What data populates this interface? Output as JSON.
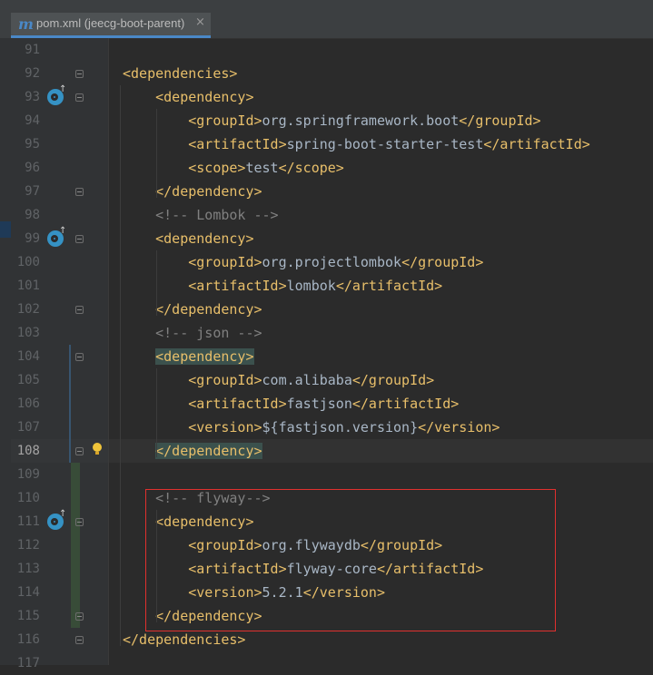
{
  "tab": {
    "icon": "maven-m-icon",
    "icon_text": "m",
    "title": "pom.xml (jeecg-boot-parent)",
    "close": "×"
  },
  "editor": {
    "lines": [
      {
        "num": "91",
        "indent": "",
        "parts": []
      },
      {
        "num": "92",
        "indent": "",
        "parts": [
          {
            "k": "tag",
            "v": "<dependencies>"
          }
        ]
      },
      {
        "num": "93",
        "indent": "    ",
        "parts": [
          {
            "k": "tag",
            "v": "<dependency>"
          }
        ]
      },
      {
        "num": "94",
        "indent": "        ",
        "parts": [
          {
            "k": "tag",
            "v": "<groupId>"
          },
          {
            "k": "text",
            "v": "org.springframework.boot"
          },
          {
            "k": "tag",
            "v": "</groupId>"
          }
        ]
      },
      {
        "num": "95",
        "indent": "        ",
        "parts": [
          {
            "k": "tag",
            "v": "<artifactId>"
          },
          {
            "k": "text",
            "v": "spring-boot-starter-test"
          },
          {
            "k": "tag",
            "v": "</artifactId>"
          }
        ]
      },
      {
        "num": "96",
        "indent": "        ",
        "parts": [
          {
            "k": "tag",
            "v": "<scope>"
          },
          {
            "k": "text",
            "v": "test"
          },
          {
            "k": "tag",
            "v": "</scope>"
          }
        ]
      },
      {
        "num": "97",
        "indent": "    ",
        "parts": [
          {
            "k": "tag",
            "v": "</dependency>"
          }
        ]
      },
      {
        "num": "98",
        "indent": "    ",
        "parts": [
          {
            "k": "comment",
            "v": "<!-- Lombok -->"
          }
        ]
      },
      {
        "num": "99",
        "indent": "    ",
        "parts": [
          {
            "k": "tag",
            "v": "<dependency>"
          }
        ]
      },
      {
        "num": "100",
        "indent": "        ",
        "parts": [
          {
            "k": "tag",
            "v": "<groupId>"
          },
          {
            "k": "text",
            "v": "org.projectlombok"
          },
          {
            "k": "tag",
            "v": "</groupId>"
          }
        ]
      },
      {
        "num": "101",
        "indent": "        ",
        "parts": [
          {
            "k": "tag",
            "v": "<artifactId>"
          },
          {
            "k": "text",
            "v": "lombok"
          },
          {
            "k": "tag",
            "v": "</artifactId>"
          }
        ]
      },
      {
        "num": "102",
        "indent": "    ",
        "parts": [
          {
            "k": "tag",
            "v": "</dependency>"
          }
        ]
      },
      {
        "num": "103",
        "indent": "    ",
        "parts": [
          {
            "k": "comment",
            "v": "<!-- json -->"
          }
        ]
      },
      {
        "num": "104",
        "indent": "    ",
        "parts": [
          {
            "k": "match",
            "v": "<dependency>"
          }
        ]
      },
      {
        "num": "105",
        "indent": "        ",
        "parts": [
          {
            "k": "tag",
            "v": "<groupId>"
          },
          {
            "k": "text",
            "v": "com.alibaba"
          },
          {
            "k": "tag",
            "v": "</groupId>"
          }
        ]
      },
      {
        "num": "106",
        "indent": "        ",
        "parts": [
          {
            "k": "tag",
            "v": "<artifactId>"
          },
          {
            "k": "text",
            "v": "fastjson"
          },
          {
            "k": "tag",
            "v": "</artifactId>"
          }
        ]
      },
      {
        "num": "107",
        "indent": "        ",
        "parts": [
          {
            "k": "tag",
            "v": "<version>"
          },
          {
            "k": "text",
            "v": "${fastjson.version}"
          },
          {
            "k": "tag",
            "v": "</version>"
          }
        ]
      },
      {
        "num": "108",
        "indent": "    ",
        "parts": [
          {
            "k": "match",
            "v": "</dependency>"
          }
        ]
      },
      {
        "num": "109",
        "indent": "",
        "parts": []
      },
      {
        "num": "110",
        "indent": "    ",
        "parts": [
          {
            "k": "comment",
            "v": "<!-- flyway-->"
          }
        ]
      },
      {
        "num": "111",
        "indent": "    ",
        "parts": [
          {
            "k": "tag",
            "v": "<dependency>"
          }
        ]
      },
      {
        "num": "112",
        "indent": "        ",
        "parts": [
          {
            "k": "tag",
            "v": "<groupId>"
          },
          {
            "k": "text",
            "v": "org.flywaydb"
          },
          {
            "k": "tag",
            "v": "</groupId>"
          }
        ]
      },
      {
        "num": "113",
        "indent": "        ",
        "parts": [
          {
            "k": "tag",
            "v": "<artifactId>"
          },
          {
            "k": "text",
            "v": "flyway-core"
          },
          {
            "k": "tag",
            "v": "</artifactId>"
          }
        ]
      },
      {
        "num": "114",
        "indent": "        ",
        "parts": [
          {
            "k": "tag",
            "v": "<version>"
          },
          {
            "k": "text",
            "v": "5.2.1"
          },
          {
            "k": "tag",
            "v": "</version>"
          }
        ]
      },
      {
        "num": "115",
        "indent": "    ",
        "parts": [
          {
            "k": "tag",
            "v": "</dependency>"
          }
        ]
      },
      {
        "num": "116",
        "indent": "",
        "parts": [
          {
            "k": "tag",
            "v": "</dependencies>"
          }
        ]
      },
      {
        "num": "117",
        "indent": "",
        "parts": []
      }
    ],
    "current_line": "108",
    "maven_icon_lines": [
      "93",
      "99",
      "111"
    ],
    "fold_lines": [
      "92",
      "93",
      "97",
      "99",
      "102",
      "104",
      "108",
      "111",
      "115",
      "116"
    ],
    "bulb_line": "108",
    "highlight_box": "red"
  },
  "colors": {
    "background": "#2b2b2b",
    "tag": "#e8bf6a",
    "text": "#a9b7c6",
    "comment": "#808080",
    "match": "#3b514d",
    "box": "#e0302e"
  }
}
